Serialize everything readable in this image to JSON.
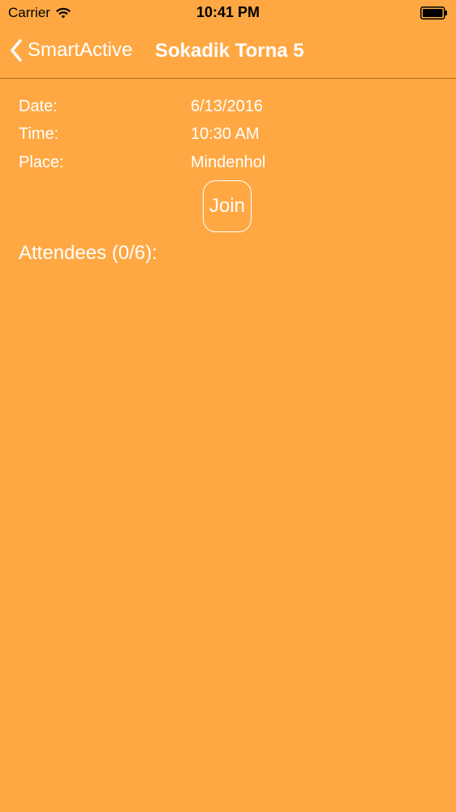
{
  "status_bar": {
    "carrier": "Carrier",
    "time": "10:41 PM"
  },
  "nav": {
    "back_label": "SmartActive",
    "title": "Sokadik Torna 5"
  },
  "details": {
    "date_label": "Date:",
    "date_value": "6/13/2016",
    "time_label": "Time:",
    "time_value": "10:30 AM",
    "place_label": "Place:",
    "place_value": "Mindenhol"
  },
  "join_label": "Join",
  "attendees_label": "Attendees (0/6):",
  "colors": {
    "background": "#FFA843",
    "text": "#ffffff"
  },
  "icons": {
    "back": "chevron-left-icon",
    "wifi": "wifi-icon",
    "battery": "battery-icon"
  }
}
